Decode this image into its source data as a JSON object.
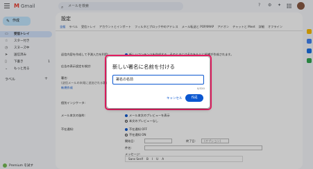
{
  "header": {
    "app_name": "Gmail",
    "search_placeholder": "メールを検索"
  },
  "sidebar": {
    "compose_label": "作成",
    "items": [
      {
        "label": "受信トレイ",
        "icon": "inbox-icon",
        "count": "",
        "active": true
      },
      {
        "label": "スター付き",
        "icon": "star-icon",
        "count": ""
      },
      {
        "label": "スヌーズ中",
        "icon": "clock-icon",
        "count": ""
      },
      {
        "label": "送信済み",
        "icon": "send-icon",
        "count": ""
      },
      {
        "label": "下書き",
        "icon": "file-icon",
        "count": "1"
      },
      {
        "label": "もっと見る",
        "icon": "chevron-down-icon",
        "count": ""
      }
    ],
    "labels_heading": "ラベル",
    "promo_text": "Premium を試す"
  },
  "main": {
    "title": "設定",
    "tabs": [
      "全般",
      "ラベル",
      "受信トレイ",
      "アカウントとインポート",
      "フィルタとブロック中のアドレス",
      "メール転送と POP/IMAP",
      "アドオン",
      "チャットと Meet",
      "詳細",
      "オフライン",
      "テーマ"
    ],
    "rows": [
      {
        "label": "返信内容を作成して予測入力を利用:",
        "value": "新しいコンテンツを作成する。そのときにはそれをもとに候補が作成されます。"
      },
      {
        "label": "広告の表示設定を検討:",
        "value": ""
      },
      {
        "label": "署名:",
        "value": "新規作成",
        "sub": "(送信メールの末尾に追加される署名)"
      },
      {
        "label": "個別インジケータ:",
        "value": "インジケータなし"
      },
      {
        "label": "メール本文の抜粋:",
        "value": "メール本文のプレビューを表示",
        "value2": "本文のプレビューなし"
      },
      {
        "label": "不在通知:",
        "value": "不在通知 OFF",
        "value2": "不在通知 ON"
      }
    ],
    "vacation_fields": {
      "start_label": "開始日:",
      "end_label": "終了日:",
      "subject_label": "件名:",
      "message_label": "メッセージ:",
      "optional": "(オプション)"
    },
    "toolbar_items": [
      "Sans Serif",
      "B",
      "I",
      "U",
      "A"
    ]
  },
  "dialog": {
    "title": "新しい署名に名前を付ける",
    "input_value": "署名の名前",
    "counter": "0/320",
    "cancel_label": "キャンセル",
    "create_label": "作成"
  },
  "colors": {
    "highlight": "#e91e63",
    "accent": "#0b57d0"
  }
}
